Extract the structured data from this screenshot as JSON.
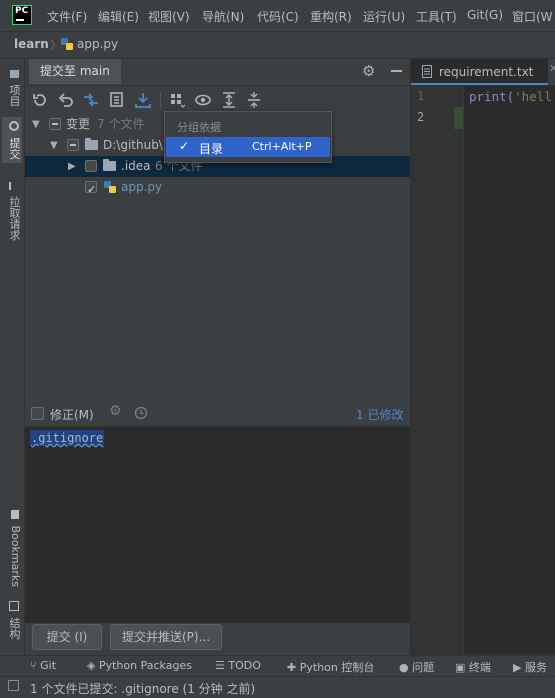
{
  "menubar": {
    "items": [
      "文件(F)",
      "编辑(E)",
      "视图(V)",
      "导航(N)",
      "代码(C)",
      "重构(R)",
      "运行(U)",
      "工具(T)",
      "Git(G)",
      "窗口(W"
    ]
  },
  "app_logo": "PC",
  "navbar": {
    "project": "learn",
    "file": "app.py"
  },
  "left_stripe": {
    "project": "项目",
    "commit": "提交",
    "pull_requests": "拉取请求",
    "bookmarks": "Bookmarks",
    "structure": "结构"
  },
  "commit_panel": {
    "tab_title": "提交至 main",
    "group_changes": {
      "label": "变更",
      "count": "7 个文件"
    },
    "folder_path": "D:\\github\\l",
    "idea_folder": {
      "name": ".idea",
      "count": "6 个文件"
    },
    "file": "app.py",
    "amend_label": "修正(M)",
    "modified_count": "1 已修改",
    "message": ".gitignore",
    "commit_button": "提交 (I)",
    "commit_push_button": "提交并推送(P)..."
  },
  "popup": {
    "title": "分组依据",
    "item_label": "目录",
    "item_shortcut": "Ctrl+Alt+P"
  },
  "editor": {
    "tab": "requirement.txt",
    "line_numbers": [
      "1",
      "2"
    ],
    "code_line1_fn": "print(",
    "code_line1_str": "'hell"
  },
  "bottom_tabs": [
    "Git",
    "Python Packages",
    "TODO",
    "Python 控制台",
    "问题",
    "终端",
    "服务"
  ],
  "status": "1 个文件已提交: .gitignore (1 分钟 之前)",
  "colors": {
    "accent": "#4a88c7",
    "selection": "#0d293e",
    "popup_selected": "#2f65ca",
    "logo_border": "#21d789"
  }
}
